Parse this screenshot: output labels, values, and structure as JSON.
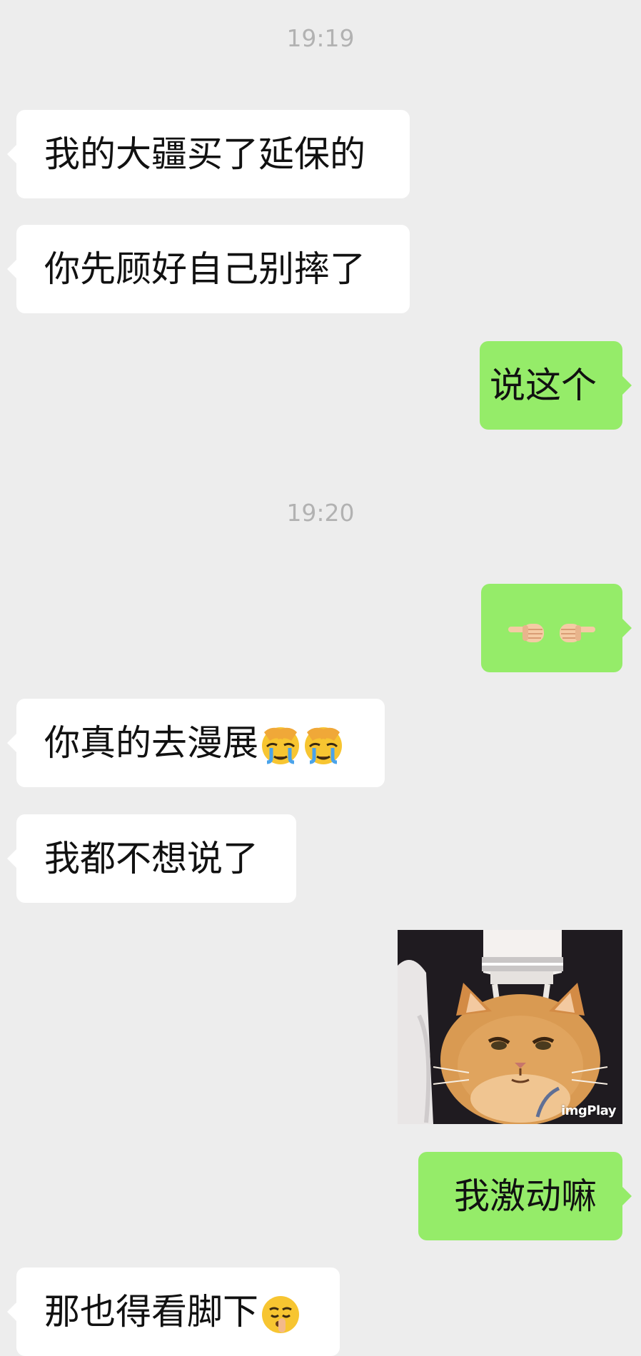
{
  "chat": {
    "timestamps": [
      "19:19",
      "19:20"
    ],
    "messages": [
      {
        "side": "left",
        "text": "我的大疆买了延保的"
      },
      {
        "side": "left",
        "text": "你先顾好自己别摔了"
      },
      {
        "side": "right",
        "text": "说这个"
      },
      {
        "side": "right",
        "text": "",
        "emoji": [
          "point-left-icon",
          "point-right-icon"
        ]
      },
      {
        "side": "left",
        "text": "你真的去漫展",
        "emoji": [
          "face-palm-crying-icon",
          "face-palm-crying-icon"
        ]
      },
      {
        "side": "left",
        "text": "我都不想说了"
      },
      {
        "side": "right",
        "type": "image",
        "alt": "cat-with-head-massager-sticker",
        "watermark": "imgPlay"
      },
      {
        "side": "right",
        "text": "我激动嘛"
      },
      {
        "side": "left",
        "text": "那也得看脚下",
        "emoji": [
          "shushing-face-icon"
        ]
      }
    ]
  },
  "colors": {
    "background": "#ededed",
    "incoming_bubble": "#ffffff",
    "outgoing_bubble": "#95ec69",
    "timestamp_text": "#b2b2b2",
    "message_text": "#111111"
  }
}
